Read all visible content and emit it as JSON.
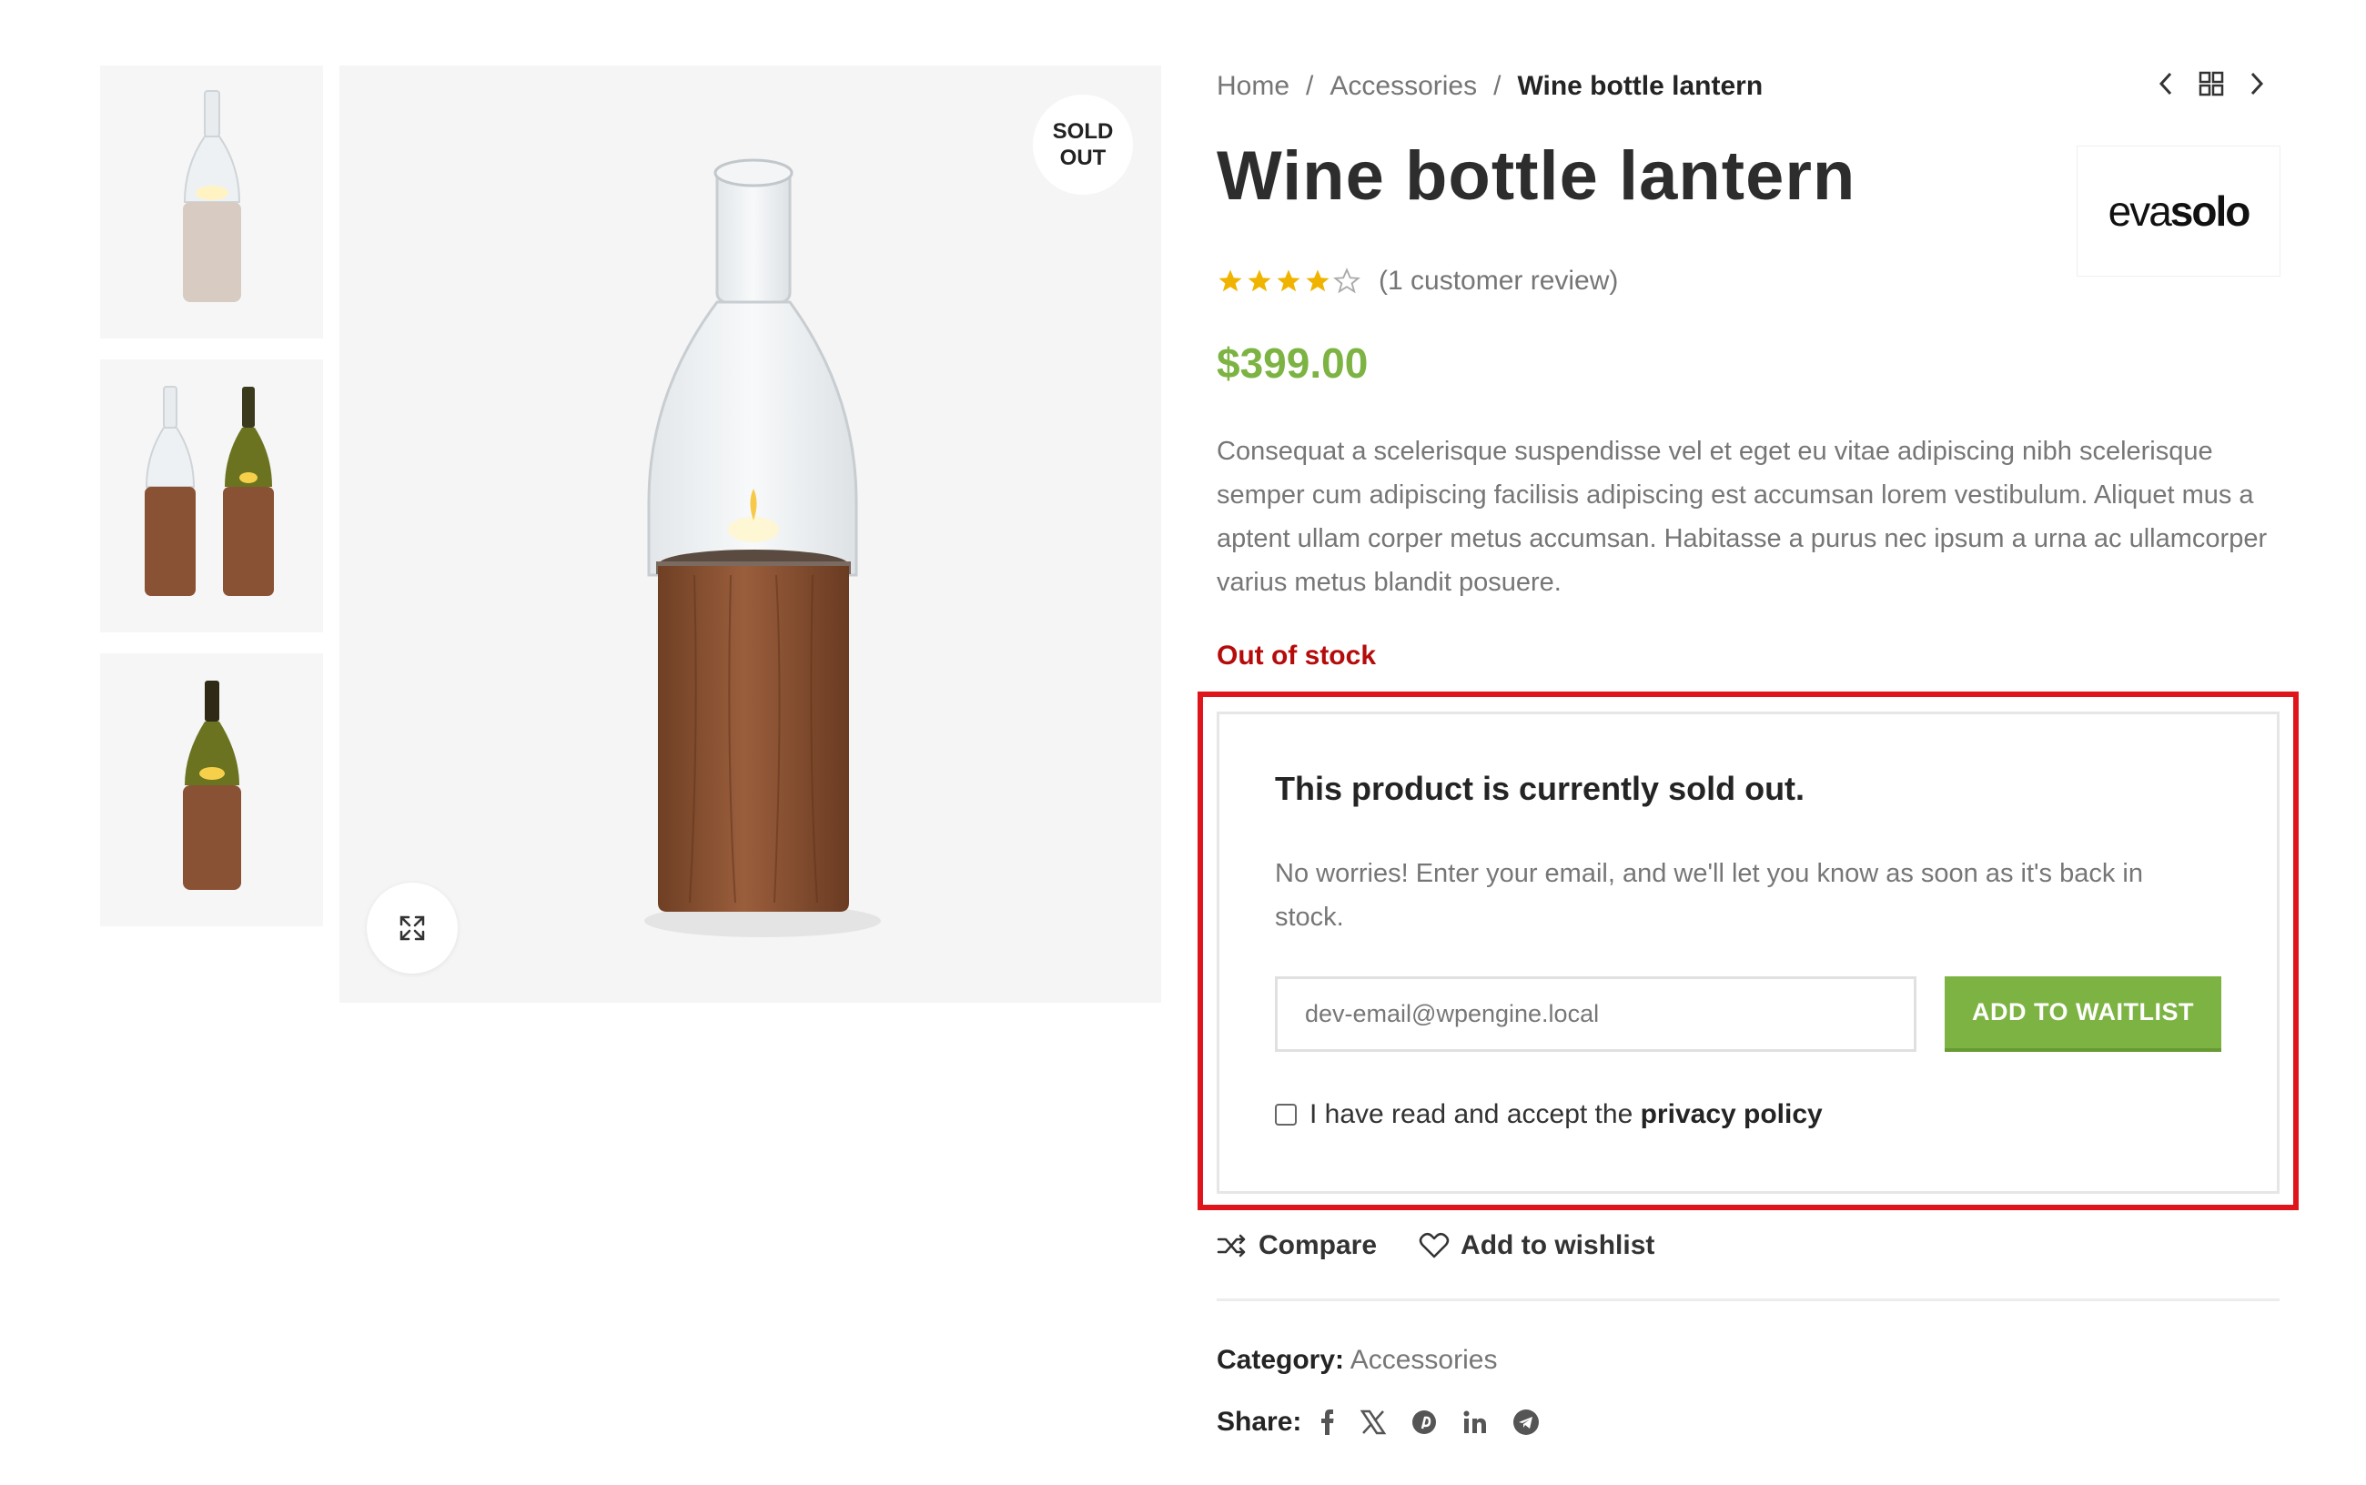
{
  "breadcrumb": {
    "home": "Home",
    "separator": "/",
    "category": "Accessories",
    "current": "Wine bottle lantern"
  },
  "product": {
    "title": "Wine bottle lantern",
    "brand": {
      "light": "eva",
      "bold": "solo"
    },
    "rating": {
      "stars": 4,
      "max": 5,
      "review_text": "(1 customer review)"
    },
    "price": "$399.00",
    "description": "Consequat a scelerisque suspendisse vel et eget eu vitae adipiscing nibh scelerisque semper cum adipiscing facilisis adipiscing est accumsan lorem vestibulum. Aliquet mus a aptent ullam corper metus accumsan. Habitasse a purus nec ipsum a urna ac ullamcorper varius metus blandit posuere.",
    "stock_status": "Out of stock"
  },
  "gallery": {
    "badge_line1": "SOLD",
    "badge_line2": "OUT",
    "thumbnails": [
      "wood-lantern-clear",
      "wood-lantern-pair",
      "wood-lantern-green"
    ]
  },
  "waitlist": {
    "title": "This product is currently sold out.",
    "message": "No worries! Enter your email, and we'll let you know as soon as it's back in stock.",
    "email_value": "dev-email@wpengine.local",
    "button_label": "ADD TO WAITLIST",
    "privacy_prefix": "I have read and accept the",
    "privacy_link": "privacy policy"
  },
  "actions": {
    "compare": "Compare",
    "wishlist": "Add to wishlist"
  },
  "meta": {
    "category_label": "Category:",
    "category_value": "Accessories",
    "share_label": "Share:",
    "share_icons": [
      "facebook-icon",
      "x-icon",
      "pinterest-icon",
      "linkedin-icon",
      "telegram-icon"
    ]
  },
  "colors": {
    "accent_green": "#7cb342",
    "out_of_stock_red": "#b50b0b",
    "highlight_red": "#e0151b"
  }
}
